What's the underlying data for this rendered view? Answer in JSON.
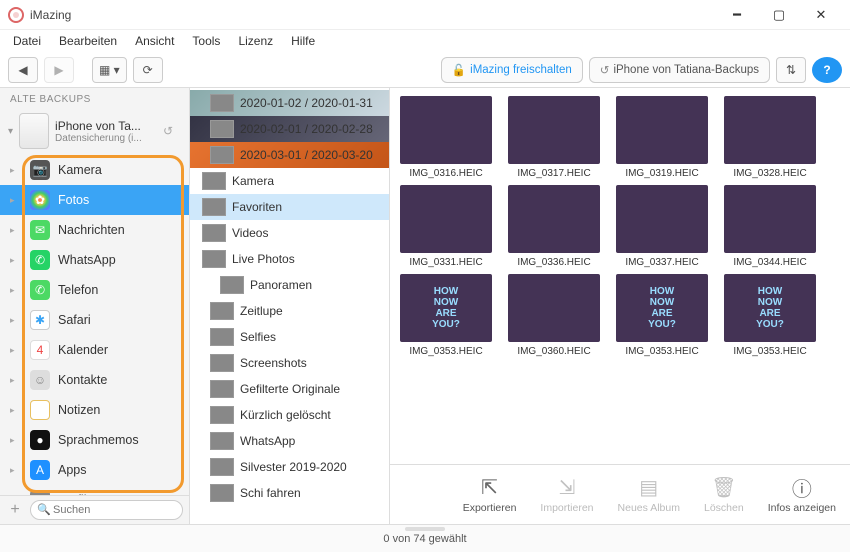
{
  "app": {
    "title": "iMazing"
  },
  "menus": [
    "Datei",
    "Bearbeiten",
    "Ansicht",
    "Tools",
    "Lizenz",
    "Hilfe"
  ],
  "toolbar": {
    "unlock_label": "iMazing freischalten",
    "device_btn_label": "iPhone von Tatiana-Backups"
  },
  "sidebar": {
    "header": "ALTE BACKUPS",
    "device_name": "iPhone von Ta...",
    "device_sub": "Datensicherung (i...",
    "items": [
      {
        "label": "Kamera",
        "icon": "camera",
        "cls": "bg-camera",
        "glyph": "📷"
      },
      {
        "label": "Fotos",
        "icon": "photos",
        "cls": "bg-photos",
        "glyph": "✿",
        "selected": true
      },
      {
        "label": "Nachrichten",
        "icon": "messages",
        "cls": "bg-msg",
        "glyph": "✉"
      },
      {
        "label": "WhatsApp",
        "icon": "whatsapp",
        "cls": "bg-wa",
        "glyph": "✆"
      },
      {
        "label": "Telefon",
        "icon": "phone",
        "cls": "bg-phone",
        "glyph": "✆"
      },
      {
        "label": "Safari",
        "icon": "safari",
        "cls": "bg-safari",
        "glyph": "✱"
      },
      {
        "label": "Kalender",
        "icon": "calendar",
        "cls": "bg-cal",
        "glyph": "4"
      },
      {
        "label": "Kontakte",
        "icon": "contacts",
        "cls": "bg-contacts",
        "glyph": "☺"
      },
      {
        "label": "Notizen",
        "icon": "notes",
        "cls": "bg-notes",
        "glyph": ""
      },
      {
        "label": "Sprachmemos",
        "icon": "voicememos",
        "cls": "bg-voice",
        "glyph": "●"
      },
      {
        "label": "Apps",
        "icon": "apps",
        "cls": "bg-apps",
        "glyph": "A"
      },
      {
        "label": "Profile",
        "icon": "profile",
        "cls": "bg-profile",
        "glyph": "⚙"
      }
    ],
    "search_placeholder": "Suchen"
  },
  "tree": [
    {
      "label": "2020-01-02 / 2020-01-31",
      "cls": "child tc4"
    },
    {
      "label": "2020-02-01 / 2020-02-28",
      "cls": "child tc3"
    },
    {
      "label": "2020-03-01 / 2020-03-20",
      "cls": "child tc2"
    },
    {
      "label": "Kamera",
      "cls": ""
    },
    {
      "label": "Favoriten",
      "cls": "selected"
    },
    {
      "label": "Videos",
      "cls": ""
    },
    {
      "label": "Live Photos",
      "cls": ""
    },
    {
      "label": "Panoramen",
      "cls": "grandchild"
    },
    {
      "label": "Zeitlupe",
      "cls": "child"
    },
    {
      "label": "Selfies",
      "cls": "child"
    },
    {
      "label": "Screenshots",
      "cls": "child"
    },
    {
      "label": "Gefilterte Originale",
      "cls": "child"
    },
    {
      "label": "Kürzlich gelöscht",
      "cls": "child"
    },
    {
      "label": "WhatsApp",
      "cls": "child"
    },
    {
      "label": "Silvester 2019-2020",
      "cls": "child"
    },
    {
      "label": "Schi fahren",
      "cls": "child"
    }
  ],
  "grid": [
    {
      "name": "IMG_0316.HEIC",
      "cls": "tc1"
    },
    {
      "name": "IMG_0317.HEIC",
      "cls": "tc2"
    },
    {
      "name": "IMG_0319.HEIC",
      "cls": "tc3"
    },
    {
      "name": "IMG_0328.HEIC",
      "cls": "tc4"
    },
    {
      "name": "IMG_0331.HEIC",
      "cls": "tc5"
    },
    {
      "name": "IMG_0336.HEIC",
      "cls": "tc6"
    },
    {
      "name": "IMG_0337.HEIC",
      "cls": "tc1"
    },
    {
      "name": "IMG_0344.HEIC",
      "cls": "tc4"
    },
    {
      "name": "IMG_0353.HEIC",
      "cls": "tc7",
      "neon": true
    },
    {
      "name": "IMG_0360.HEIC",
      "cls": "tc6"
    },
    {
      "name": "IMG_0353.HEIC",
      "cls": "tc7",
      "neon": true
    },
    {
      "name": "IMG_0353.HEIC",
      "cls": "tc7",
      "neon": true
    }
  ],
  "actions": [
    {
      "label": "Exportieren",
      "icon": "export",
      "enabled": true
    },
    {
      "label": "Importieren",
      "icon": "import",
      "enabled": false
    },
    {
      "label": "Neues Album",
      "icon": "new-album",
      "enabled": false
    },
    {
      "label": "Löschen",
      "icon": "delete",
      "enabled": false
    },
    {
      "label": "Infos anzeigen",
      "icon": "info",
      "enabled": true
    }
  ],
  "status": "0 von 74 gewählt"
}
